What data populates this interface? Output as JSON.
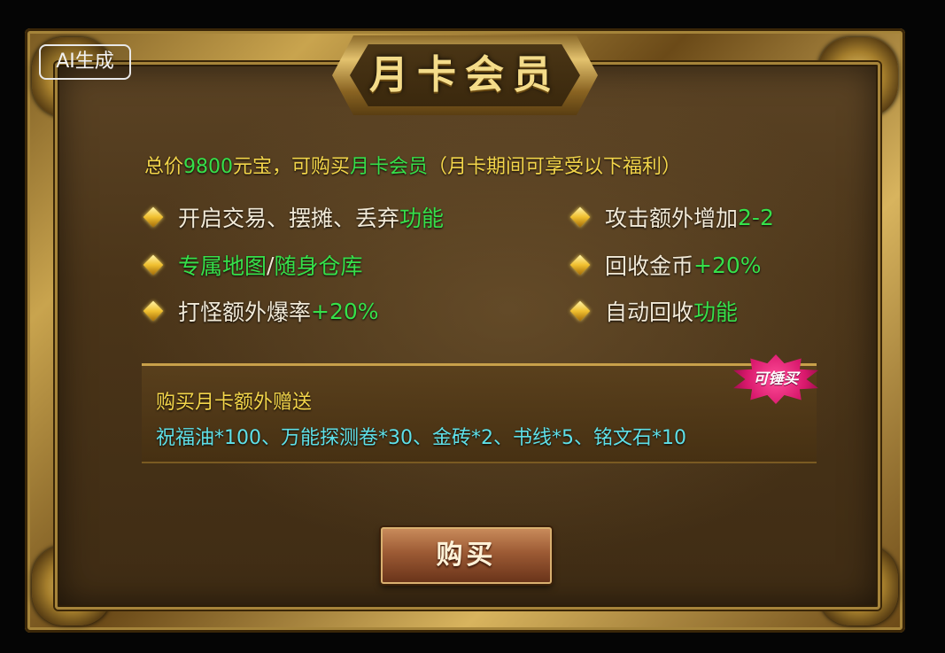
{
  "watermark": "AI生成",
  "title": "月卡会员",
  "intro": {
    "p1": "总价",
    "price": "9800",
    "p2": "元宝，可购买",
    "name": "月卡会员",
    "p3": "（月卡期间可享受以下福利）"
  },
  "benefits_left": [
    {
      "text": "开启交易、摆摊、丢弃",
      "hl": "功能"
    },
    {
      "hl": "专属地图",
      "sep": "/",
      "hl2": "随身仓库"
    },
    {
      "text": "打怪额外爆率",
      "hl": "+20%"
    }
  ],
  "benefits_right": [
    {
      "text": "攻击额外增加",
      "hl": "2-2"
    },
    {
      "text": "回收金币",
      "hl": "+20%"
    },
    {
      "text": "自动回收",
      "hl": "功能"
    }
  ],
  "bonus": {
    "title": "购买月卡额外赠送",
    "items": "祝福油*100、万能探测卷*30、金砖*2、书线*5、铭文石*10",
    "badge": "可锤买"
  },
  "buy_button": "购买",
  "colors": {
    "highlight_green": "#36e04a",
    "highlight_yellow": "#f3d54a",
    "bonus_cyan": "#5fe0e8",
    "frame_gold": "#c9a44e"
  }
}
